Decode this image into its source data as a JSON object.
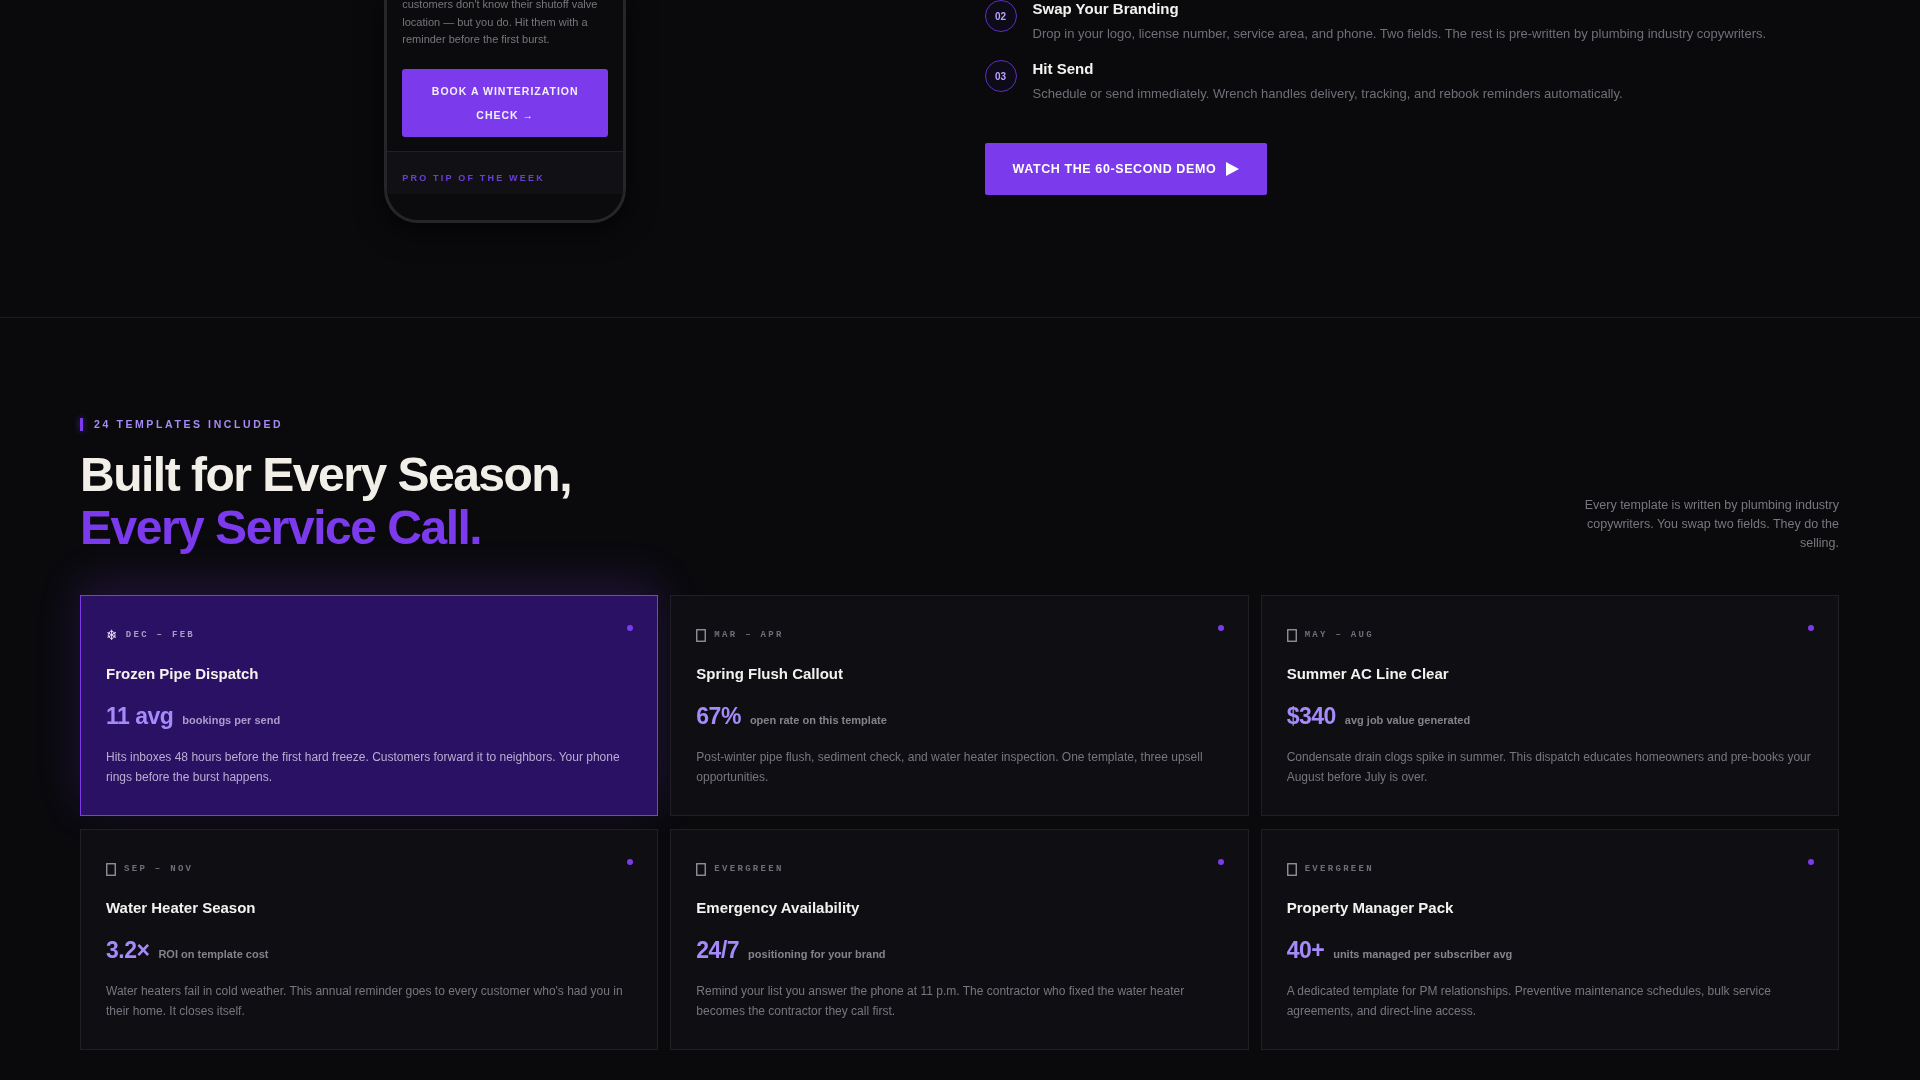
{
  "phone": {
    "text": "customers don't know their shutoff valve location — but you do. Hit them with a reminder before the first burst.",
    "button": "BOOK A WINTERIZATION CHECK →",
    "footer_label": "PRO TIP OF THE WEEK"
  },
  "steps": [
    {
      "number": "02",
      "title": "Swap Your Branding",
      "description": "Drop in your logo, license number, service area, and phone. Two fields. The rest is pre-written by plumbing industry copywriters."
    },
    {
      "number": "03",
      "title": "Hit Send",
      "description": "Schedule or send immediately. Wrench handles delivery, tracking, and rebook reminders automatically."
    }
  ],
  "demo_button": {
    "label": "WATCH THE 60-SECOND DEMO"
  },
  "templates_section": {
    "eyebrow": "24 TEMPLATES INCLUDED",
    "heading": "Built for Every Season,",
    "heading_accent": "Every Service Call.",
    "intro": "Every template is written by plumbing industry copywriters. You swap two fields. They do the selling."
  },
  "cards": [
    {
      "highlighted": true,
      "icon": "❄",
      "season": "DEC – FEB",
      "title": "Frozen Pipe Dispatch",
      "stat": "11 avg",
      "stat_label": "bookings per send",
      "description": "Hits inboxes 48 hours before the first hard freeze. Customers forward it to neighbors. Your phone rings before the burst happens."
    },
    {
      "highlighted": false,
      "season": "MAR – APR",
      "title": "Spring Flush Callout",
      "stat": "67%",
      "stat_label": "open rate on this template",
      "description": "Post-winter pipe flush, sediment check, and water heater inspection. One template, three upsell opportunities."
    },
    {
      "highlighted": false,
      "season": "MAY – AUG",
      "title": "Summer AC Line Clear",
      "stat": "$340",
      "stat_label": "avg job value generated",
      "description": "Condensate drain clogs spike in summer. This dispatch educates homeowners and pre-books your August before July is over."
    },
    {
      "highlighted": false,
      "season": "SEP – NOV",
      "title": "Water Heater Season",
      "stat": "3.2×",
      "stat_label": "ROI on template cost",
      "description": "Water heaters fail in cold weather. This annual reminder goes to every customer who's had you in their home. It closes itself."
    },
    {
      "highlighted": false,
      "season": "EVERGREEN",
      "title": "Emergency Availability",
      "stat": "24/7",
      "stat_label": "positioning for your brand",
      "description": "Remind your list you answer the phone at 11 p.m. The contractor who fixed the water heater becomes the contractor they call first."
    },
    {
      "highlighted": false,
      "season": "EVERGREEN",
      "title": "Property Manager Pack",
      "stat": "40+",
      "stat_label": "units managed per subscriber avg",
      "description": "A dedicated template for PM relationships. Preventive maintenance schedules, bulk service agreements, and direct-line access."
    }
  ]
}
